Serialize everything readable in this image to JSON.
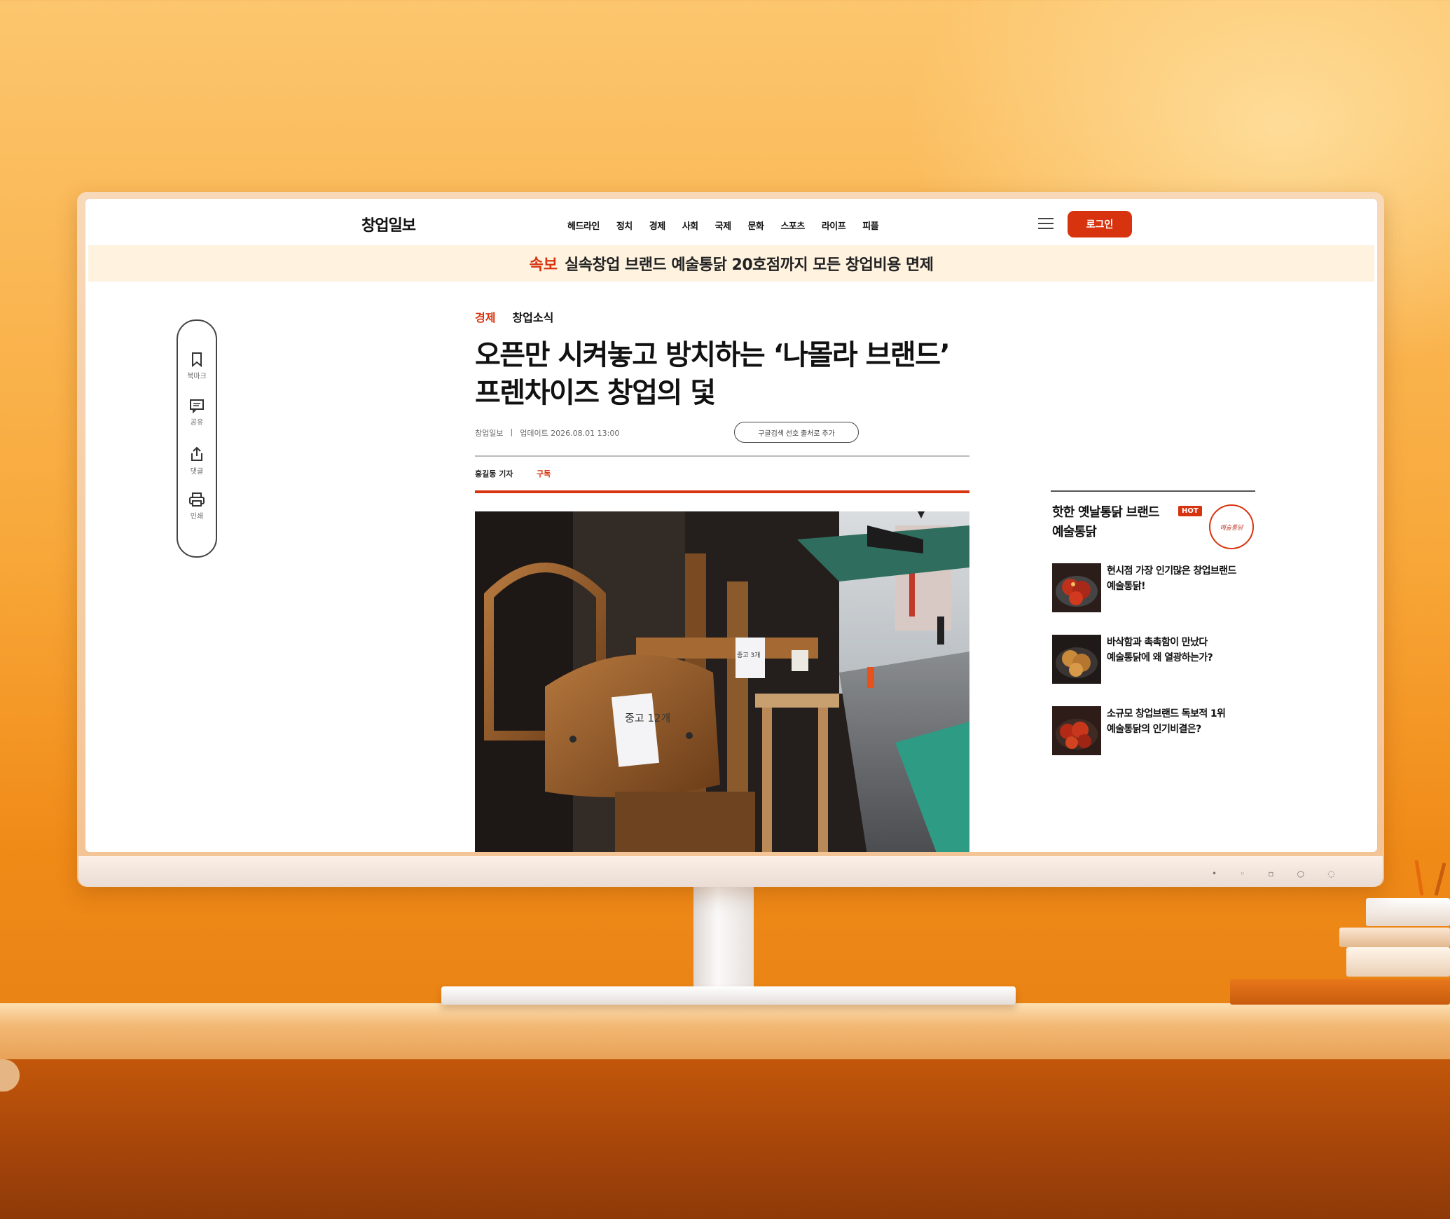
{
  "site": {
    "name": "창업일보"
  },
  "nav": [
    "헤드라인",
    "정치",
    "경제",
    "사회",
    "국제",
    "문화",
    "스포츠",
    "라이프",
    "피플"
  ],
  "header": {
    "login_label": "로그인"
  },
  "breaking": {
    "tag": "속보",
    "text": "실속창업 브랜드 예술통닭 20호점까지 모든 창업비용 면제"
  },
  "tools": [
    {
      "label": "북마크",
      "icon": "bookmark-icon"
    },
    {
      "label": "공유",
      "icon": "comment-icon"
    },
    {
      "label": "댓글",
      "icon": "share-icon"
    },
    {
      "label": "인쇄",
      "icon": "print-icon"
    }
  ],
  "article": {
    "category": "경제",
    "subcategory": "창업소식",
    "title_line1": "오픈만 시켜놓고 방치하는 ‘나몰라 브랜드’",
    "title_line2": "프렌차이즈 창업의 덫",
    "source": "창업일보",
    "separator": "|",
    "updated": "업데이트 2026.08.01 13:00",
    "google_button": "구글검색 선호 출처로 추가",
    "reporter": "홍길동 기자",
    "subscribe": "구독",
    "photo_notes": [
      "중고 12개",
      "중고 3개"
    ]
  },
  "sidebar": {
    "title_line1": "핫한 옛날통닭 브랜드",
    "title_line2": "예술통닭",
    "badge": "HOT",
    "logo_text": "예술통닭",
    "items": [
      {
        "line1": "현시점 가장 인기많은 창업브랜드",
        "line2": "예술통닭!"
      },
      {
        "line1": "바삭함과 촉촉함이 만났다",
        "line2": "예술통닭에 왜 열광하는가?"
      },
      {
        "line1": "소규모 창업브랜드 독보적 1위",
        "line2": "예술통닭의 인기비결은?"
      }
    ]
  },
  "colors": {
    "accent": "#d8330f",
    "banner_bg": "#fff3e0",
    "background": "#f8a83a"
  }
}
